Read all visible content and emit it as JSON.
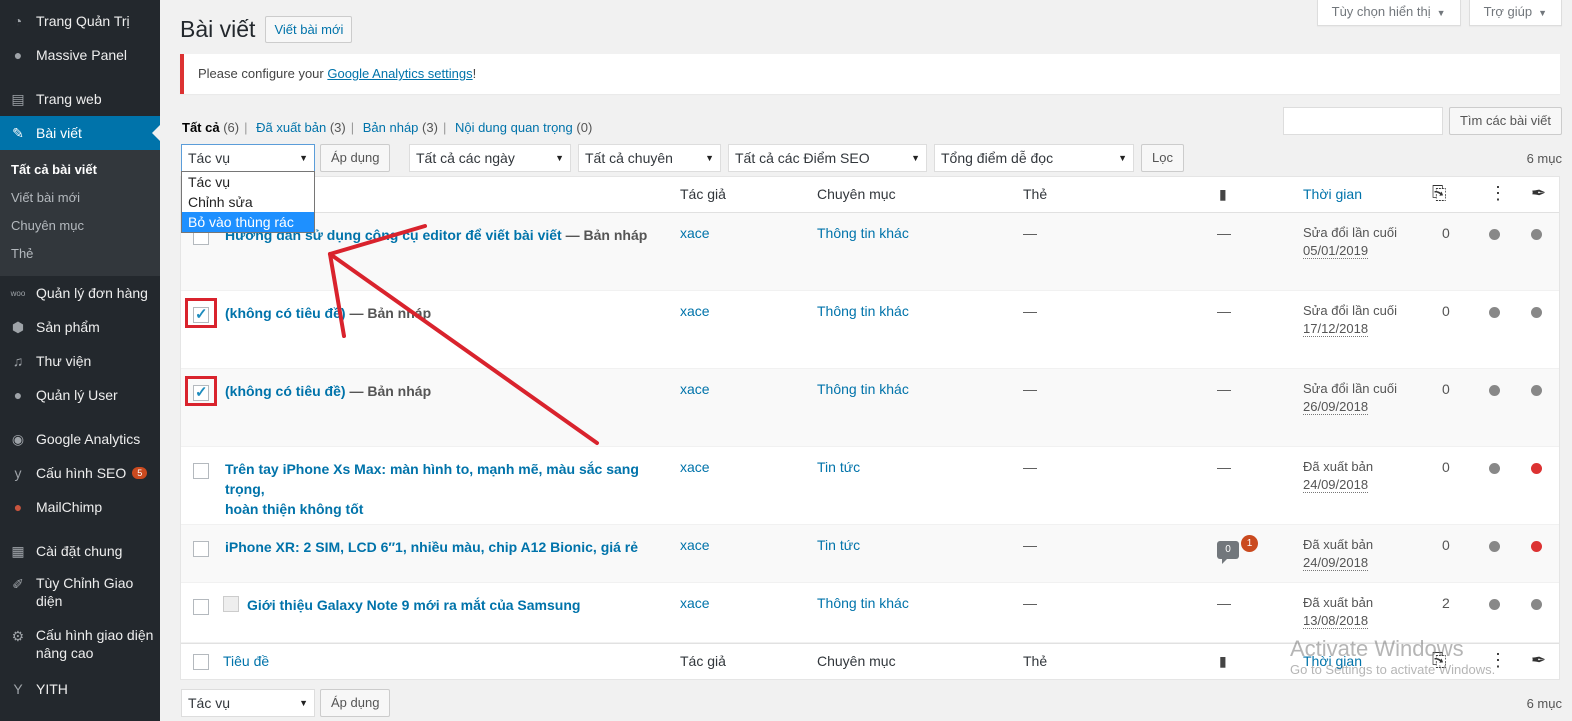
{
  "sidebar": {
    "items": [
      {
        "label": "Trang Quản Trị",
        "icon": "dashboard-icon"
      },
      {
        "label": "Massive Panel",
        "icon": "lightbulb-icon"
      },
      {
        "label": "Trang web",
        "icon": "pages-icon"
      },
      {
        "label": "Bài viết",
        "icon": "pin-icon"
      },
      {
        "label": "Quản lý đơn hàng",
        "icon": "woo-icon"
      },
      {
        "label": "Sản phẩm",
        "icon": "box-icon"
      },
      {
        "label": "Thư viện",
        "icon": "media-icon"
      },
      {
        "label": "Quản lý User",
        "icon": "user-icon"
      },
      {
        "label": "Google Analytics",
        "icon": "analytics-icon"
      },
      {
        "label": "Cấu hình SEO",
        "icon": "yoast-icon",
        "badge": "5"
      },
      {
        "label": "MailChimp",
        "icon": "mailchimp-icon"
      },
      {
        "label": "Cài đặt chung",
        "icon": "settings-icon"
      },
      {
        "label": "Tùy Chỉnh Giao diện",
        "icon": "brush-icon"
      },
      {
        "label": "Cấu hình giao diện nâng cao",
        "icon": "gear-icon"
      },
      {
        "label": "YITH",
        "icon": "yith-icon"
      }
    ],
    "submenu": [
      "Tất cả bài viết",
      "Viết bài mới",
      "Chuyên mục",
      "Thẻ"
    ]
  },
  "screen_meta": {
    "options": "Tùy chọn hiển thị",
    "help": "Trợ giúp"
  },
  "heading": {
    "title": "Bài viết",
    "add_new": "Viết bài mới"
  },
  "notice": {
    "prefix": "Please configure your ",
    "link": "Google Analytics settings",
    "suffix": "!"
  },
  "filters_links": {
    "all": "Tất cả",
    "all_count": "(6)",
    "published": "Đã xuất bản",
    "published_count": "(3)",
    "drafts": "Bản nháp",
    "drafts_count": "(3)",
    "sticky": "Nội dung quan trọng",
    "sticky_count": "(0)"
  },
  "search": {
    "button": "Tìm các bài viết"
  },
  "bulk": {
    "action": "Tác vụ",
    "apply": "Áp dụng"
  },
  "filters": {
    "dates": "Tất cả các ngày",
    "categories": "Tất cả chuyên mục",
    "seo": "Tất cả các Điểm SEO",
    "readability": "Tổng điểm dễ đọc",
    "filter_btn": "Lọc"
  },
  "item_count": "6 mục",
  "dropdown": {
    "options": [
      "Tác vụ",
      "Chỉnh sửa",
      "Bỏ vào thùng rác"
    ],
    "selected_index": 2
  },
  "columns": {
    "title": "Tiêu đề",
    "author": "Tác giả",
    "category": "Chuyên mục",
    "tags": "Thẻ",
    "date": "Thời gian"
  },
  "posts": [
    {
      "title": "Hướng dẫn sử dụng công cụ editor để viết bài viết",
      "state": " — Bản nháp",
      "author": "xace",
      "category": "Thông tin khác",
      "tags": "—",
      "comments": "—",
      "date_label": "Sửa đổi lần cuối",
      "date": "05/01/2019",
      "links": "0",
      "checked": false,
      "seo": "grey",
      "read": "grey"
    },
    {
      "title": "(không có tiêu đề)",
      "state": " — Bản nháp",
      "author": "xace",
      "category": "Thông tin khác",
      "tags": "—",
      "comments": "—",
      "date_label": "Sửa đổi lần cuối",
      "date": "17/12/2018",
      "links": "0",
      "checked": true,
      "seo": "grey",
      "read": "grey"
    },
    {
      "title": "(không có tiêu đề)",
      "state": " — Bản nháp",
      "author": "xace",
      "category": "Thông tin khác",
      "tags": "—",
      "comments": "—",
      "date_label": "Sửa đổi lần cuối",
      "date": "26/09/2018",
      "links": "0",
      "checked": true,
      "seo": "grey",
      "read": "grey"
    },
    {
      "title": "Trên tay iPhone Xs Max: màn hình to, mạnh mẽ, màu sắc sang trọng,",
      "title2": "hoàn thiện không tốt",
      "state": "",
      "author": "xace",
      "category": "Tin tức",
      "tags": "—",
      "comments": "—",
      "date_label": "Đã xuất bản",
      "date": "24/09/2018",
      "links": "0",
      "checked": false,
      "seo": "grey",
      "read": "red"
    },
    {
      "title": "iPhone XR: 2 SIM, LCD 6″1, nhiều màu, chip A12 Bionic, giá rẻ",
      "state": "",
      "author": "xace",
      "category": "Tin tức",
      "tags": "—",
      "comments_count": "0",
      "comments_pending": "1",
      "date_label": "Đã xuất bản",
      "date": "24/09/2018",
      "links": "0",
      "checked": false,
      "seo": "grey",
      "read": "red"
    },
    {
      "title": "Giới thiệu Galaxy Note 9 mới ra mắt của Samsung",
      "state": "",
      "author": "xace",
      "category": "Thông tin khác",
      "tags": "—",
      "comments": "—",
      "date_label": "Đã xuất bản",
      "date": "13/08/2018",
      "links": "2",
      "checked": false,
      "seo": "grey",
      "read": "grey"
    }
  ],
  "watermark": {
    "line1": "Activate Windows",
    "line2": "Go to Settings to activate Windows."
  },
  "colors": {
    "accent": "#0073aa",
    "sidebar": "#23282d",
    "annotation": "#d9232d"
  }
}
